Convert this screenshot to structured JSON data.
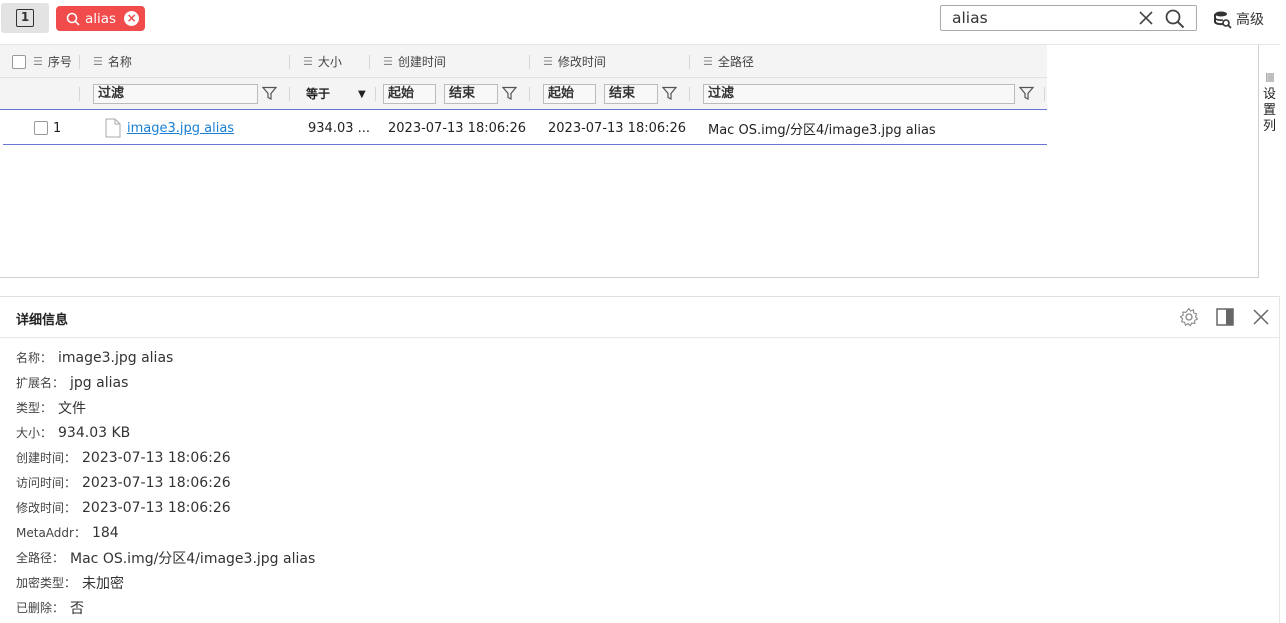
{
  "toolbar": {
    "tab_number": "1",
    "tag_label": "alias",
    "search_value": "alias",
    "advanced_label": "高级"
  },
  "grid": {
    "columns": {
      "index": "序号",
      "name": "名称",
      "size": "大小",
      "created": "创建时间",
      "modified": "修改时间",
      "path": "全路径"
    },
    "filters": {
      "name_placeholder": "过滤",
      "size_op": "等于",
      "created_start": "起始",
      "created_end": "结束",
      "modified_start": "起始",
      "modified_end": "结束",
      "path_placeholder": "过滤"
    },
    "rows": [
      {
        "index": "1",
        "name": "image3.jpg alias",
        "size": "934.03 ...",
        "created": "2023-07-13 18:06:26",
        "modified": "2023-07-13 18:06:26",
        "path": "Mac OS.img/分区4/image3.jpg alias"
      }
    ],
    "column_settings_label": [
      "设",
      "置",
      "列"
    ]
  },
  "detail": {
    "title": "详细信息",
    "props": [
      {
        "k": "名称：",
        "v": "image3.jpg alias"
      },
      {
        "k": "扩展名：",
        "v": "jpg alias"
      },
      {
        "k": "类型：",
        "v": "文件"
      },
      {
        "k": "大小：",
        "v": "934.03 KB"
      },
      {
        "k": "创建时间：",
        "v": "2023-07-13 18:06:26"
      },
      {
        "k": "访问时间：",
        "v": "2023-07-13 18:06:26"
      },
      {
        "k": "修改时间：",
        "v": "2023-07-13 18:06:26"
      },
      {
        "k": "MetaAddr：",
        "v": "184"
      },
      {
        "k": "全路径：",
        "v": "Mac OS.img/分区4/image3.jpg alias"
      },
      {
        "k": "加密类型：",
        "v": "未加密"
      },
      {
        "k": "已删除：",
        "v": "否"
      }
    ]
  },
  "colors": {
    "tag_bg": "#f24b4b",
    "link": "#1a7fd4",
    "row_border": "#6a73d6"
  }
}
